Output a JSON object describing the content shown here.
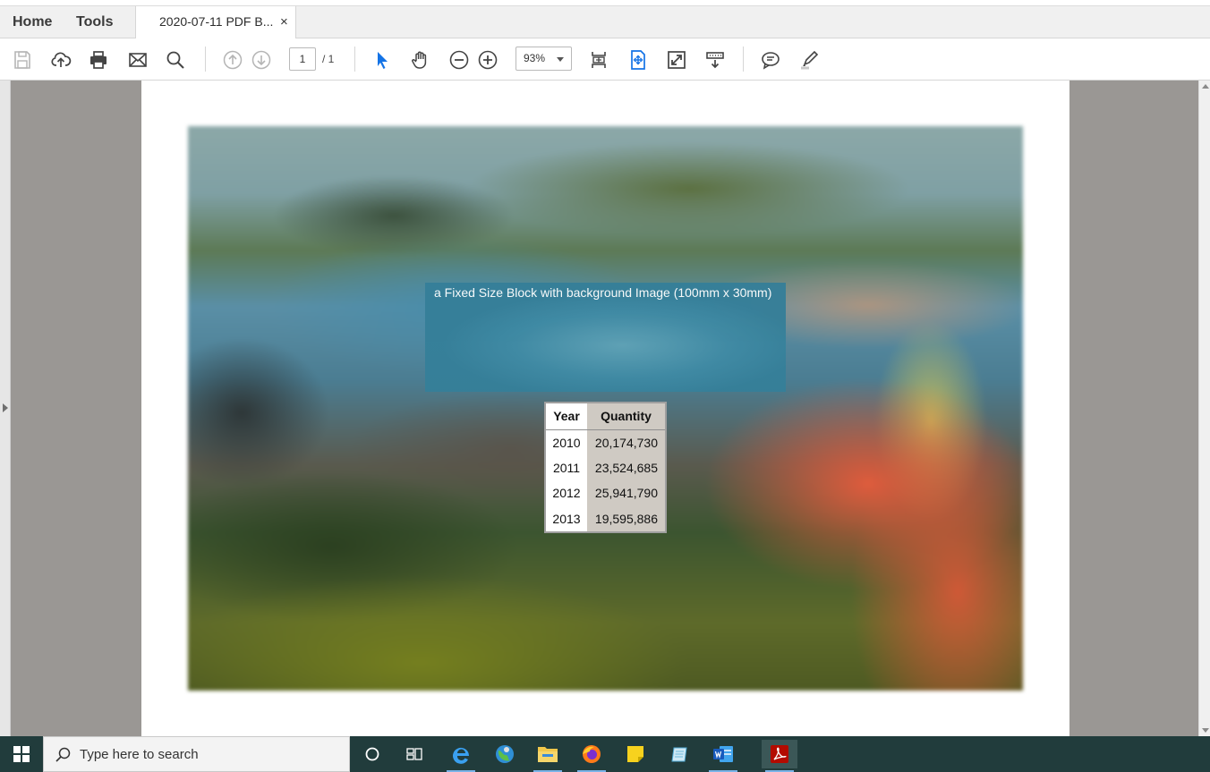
{
  "menu": {
    "home": "Home",
    "tools": "Tools"
  },
  "tab": {
    "title": "2020-07-11 PDF B...",
    "close": "×"
  },
  "toolbar": {
    "page_current": "1",
    "page_total": "/ 1",
    "zoom": "93%",
    "icons": [
      "save-icon",
      "upload-icon",
      "print-icon",
      "mail-icon",
      "search-icon",
      "prev-page-icon",
      "next-page-icon",
      "select-arrow-icon",
      "hand-icon",
      "zoom-out-icon",
      "zoom-in-icon",
      "fit-page-icon",
      "fit-width-icon",
      "fullscreen-icon",
      "read-mode-icon",
      "comment-icon",
      "highlight-icon"
    ]
  },
  "document": {
    "block_text": "a Fixed Size Block with background Image (100mm x 30mm)",
    "table": {
      "headers": [
        "Year",
        "Quantity"
      ],
      "rows": [
        [
          "2010",
          "20,174,730"
        ],
        [
          "2011",
          "23,524,685"
        ],
        [
          "2012",
          "25,941,790"
        ],
        [
          "2013",
          "19,595,886"
        ]
      ]
    }
  },
  "taskbar": {
    "search_placeholder": "Type here to search",
    "apps": [
      "cortana",
      "task-view",
      "edge",
      "maps",
      "file-explorer",
      "firefox",
      "sticky-notes",
      "notepad",
      "word",
      "acrobat"
    ]
  },
  "colors": {
    "accent": "#1473e6",
    "taskbar": "#213c3c",
    "doc_bg": "#9a9794"
  }
}
